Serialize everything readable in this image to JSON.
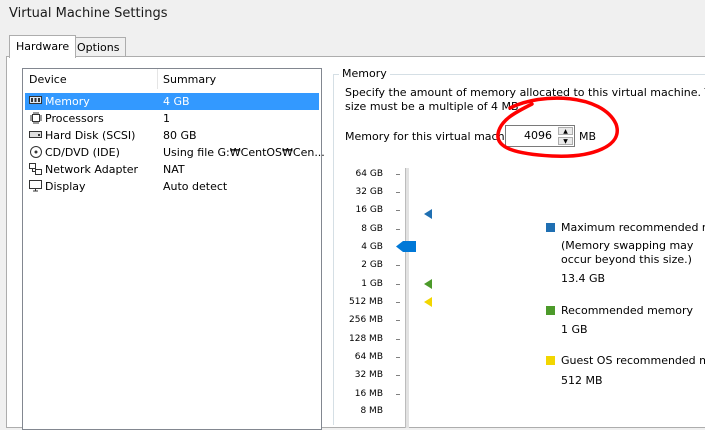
{
  "window": {
    "title": "Virtual Machine Settings"
  },
  "tabs": [
    {
      "label": "Hardware",
      "active": true
    },
    {
      "label": "Options",
      "active": false
    }
  ],
  "devices": {
    "col_device": "Device",
    "col_summary": "Summary",
    "rows": [
      {
        "device": "Memory",
        "summary": "4 GB",
        "icon": "memory-icon",
        "selected": true
      },
      {
        "device": "Processors",
        "summary": "1",
        "icon": "processor-icon",
        "selected": false
      },
      {
        "device": "Hard Disk (SCSI)",
        "summary": "80 GB",
        "icon": "hard-disk-icon",
        "selected": false
      },
      {
        "device": "CD/DVD (IDE)",
        "summary": "Using file G:₩CentOS₩Cen...",
        "icon": "cd-dvd-icon",
        "selected": false
      },
      {
        "device": "Network Adapter",
        "summary": "NAT",
        "icon": "network-adapter-icon",
        "selected": false
      },
      {
        "device": "Display",
        "summary": "Auto detect",
        "icon": "display-icon",
        "selected": false
      }
    ]
  },
  "memory": {
    "group_label": "Memory",
    "description_line1": "Specify the amount of memory allocated to this virtual machine. The memor",
    "description_line2": "size must be a multiple of 4 MB.",
    "field_label": "Memory for this virtual machine:",
    "value": "4096",
    "unit": "MB",
    "ticks": [
      "64 GB",
      "32 GB",
      "16 GB",
      "8 GB",
      "4 GB",
      "2 GB",
      "1 GB",
      "512 MB",
      "256 MB",
      "128 MB",
      "64 MB",
      "32 MB",
      "16 MB",
      "8 MB"
    ],
    "legend": {
      "max_label": "Maximum recommended memo",
      "max_note_1": "(Memory swapping may",
      "max_note_2": "occur beyond this size.)",
      "max_value": "13.4 GB",
      "rec_label": "Recommended memory",
      "rec_value": "1 GB",
      "guest_label": "Guest OS recommended minim",
      "guest_value": "512 MB"
    },
    "colors": {
      "max": "#1f6fb2",
      "recommended": "#4c9a2a",
      "guest": "#f2d600"
    }
  },
  "annotation_color": "#ff0000"
}
